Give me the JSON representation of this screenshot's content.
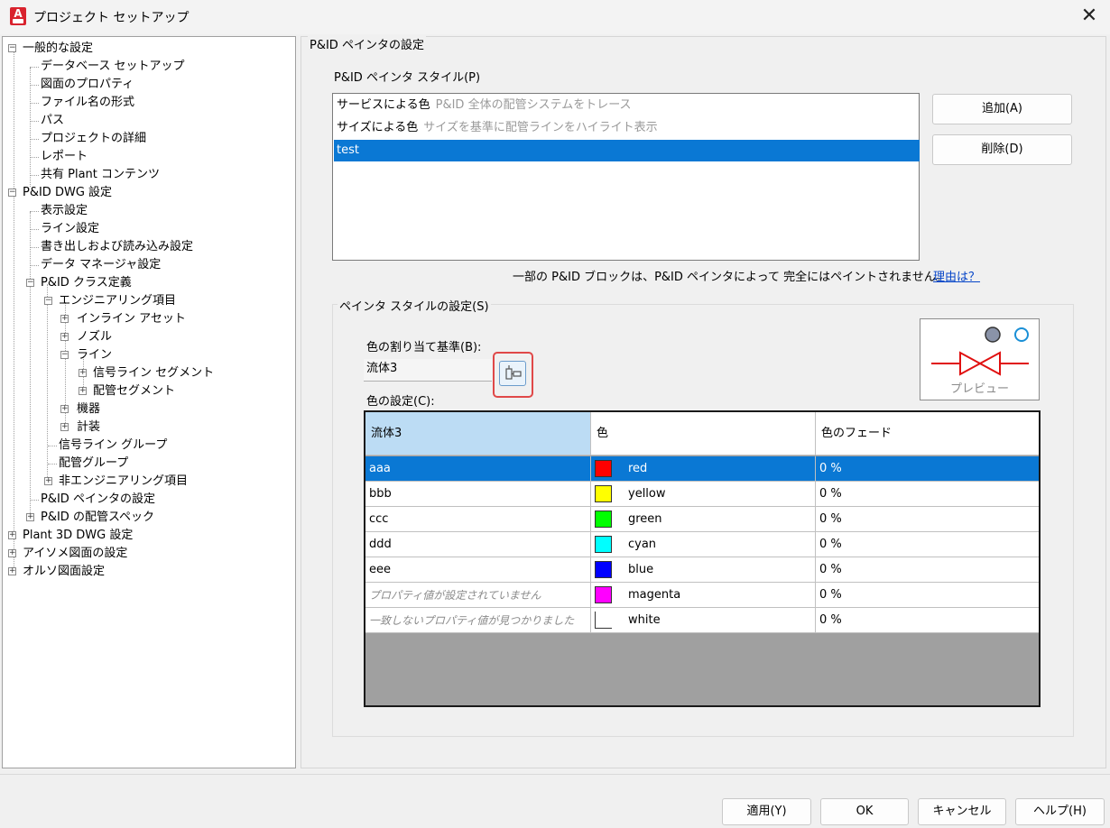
{
  "window": {
    "title": "プロジェクト セットアップ",
    "app_icon_letter": "A",
    "close_glyph": "✕"
  },
  "tree": {
    "items": [
      {
        "label": "一般的な設定",
        "expander": "−"
      },
      {
        "label": "データベース セットアップ"
      },
      {
        "label": "図面のプロパティ"
      },
      {
        "label": "ファイル名の形式"
      },
      {
        "label": "パス"
      },
      {
        "label": "プロジェクトの詳細"
      },
      {
        "label": "レポート"
      },
      {
        "label": "共有 Plant コンテンツ"
      },
      {
        "label": "P&ID DWG 設定",
        "expander": "−"
      },
      {
        "label": "表示設定"
      },
      {
        "label": "ライン設定"
      },
      {
        "label": "書き出しおよび読み込み設定"
      },
      {
        "label": "データ マネージャ設定"
      },
      {
        "label": "P&ID クラス定義",
        "expander": "−"
      },
      {
        "label": "エンジニアリング項目",
        "expander": "−"
      },
      {
        "label": "インライン アセット",
        "expander": "+"
      },
      {
        "label": "ノズル",
        "expander": "+"
      },
      {
        "label": "ライン",
        "expander": "−"
      },
      {
        "label": "信号ライン セグメント",
        "expander": "+"
      },
      {
        "label": "配管セグメント",
        "expander": "+"
      },
      {
        "label": "機器",
        "expander": "+"
      },
      {
        "label": "計装",
        "expander": "+"
      },
      {
        "label": "信号ライン グループ"
      },
      {
        "label": "配管グループ"
      },
      {
        "label": "非エンジニアリング項目",
        "expander": "+"
      },
      {
        "label": "P&ID ペインタの設定"
      },
      {
        "label": "P&ID の配管スペック",
        "expander": "+"
      },
      {
        "label": "Plant 3D DWG 設定",
        "expander": "+"
      },
      {
        "label": "アイソメ図面の設定",
        "expander": "+"
      },
      {
        "label": "オルソ図面設定",
        "expander": "+"
      }
    ]
  },
  "painter": {
    "group_title": "P&ID ペインタの設定",
    "styles_label": "P&ID ペインタ スタイル(P)",
    "styles": [
      {
        "name": "サービスによる色",
        "desc": "P&ID 全体の配管システムをトレース"
      },
      {
        "name": "サイズによる色",
        "desc": "サイズを基準に配管ラインをハイライト表示"
      },
      {
        "name": "test",
        "desc": ""
      }
    ],
    "add_label": "追加(A)",
    "delete_label": "削除(D)",
    "note": "一部の P&ID ブロックは、P&ID ペインタによって 完全にはペイントされません。",
    "note_link": "理由は？"
  },
  "style_settings": {
    "group_title": "ペインタ スタイルの設定(S)",
    "assign_label": "色の割り当て基準(B):",
    "assign_value": "流体3",
    "color_settings_label": "色の設定(C):",
    "preview_label": "プレビュー",
    "grid": {
      "headers": [
        "流体3",
        "色",
        "色のフェード"
      ],
      "rows": [
        {
          "value": "aaa",
          "color_name": "red",
          "color": "#ff0000",
          "fade": "0 %",
          "italic": false
        },
        {
          "value": "bbb",
          "color_name": "yellow",
          "color": "#ffff00",
          "fade": "0 %",
          "italic": false
        },
        {
          "value": "ccc",
          "color_name": "green",
          "color": "#00ff00",
          "fade": "0 %",
          "italic": false
        },
        {
          "value": "ddd",
          "color_name": "cyan",
          "color": "#00ffff",
          "fade": "0 %",
          "italic": false
        },
        {
          "value": "eee",
          "color_name": "blue",
          "color": "#0000ff",
          "fade": "0 %",
          "italic": false
        },
        {
          "value": "プロパティ値が設定されていません",
          "color_name": "magenta",
          "color": "#ff00ff",
          "fade": "0 %",
          "italic": true
        },
        {
          "value": "一致しないプロパティ値が見つかりました",
          "color_name": "white",
          "color": "#ffffff",
          "fade": "0 %",
          "italic": true
        }
      ]
    }
  },
  "footer": {
    "apply_label": "適用(Y)",
    "ok_label": "OK",
    "cancel_label": "キャンセル",
    "help_label": "ヘルプ(H)"
  },
  "colors": {
    "selection": "#0a78d4",
    "header_selected": "#bcdcf4",
    "valve": "#e01010",
    "dot_gray": "#8a93a8",
    "dot_blue": "#1a8fd6"
  }
}
